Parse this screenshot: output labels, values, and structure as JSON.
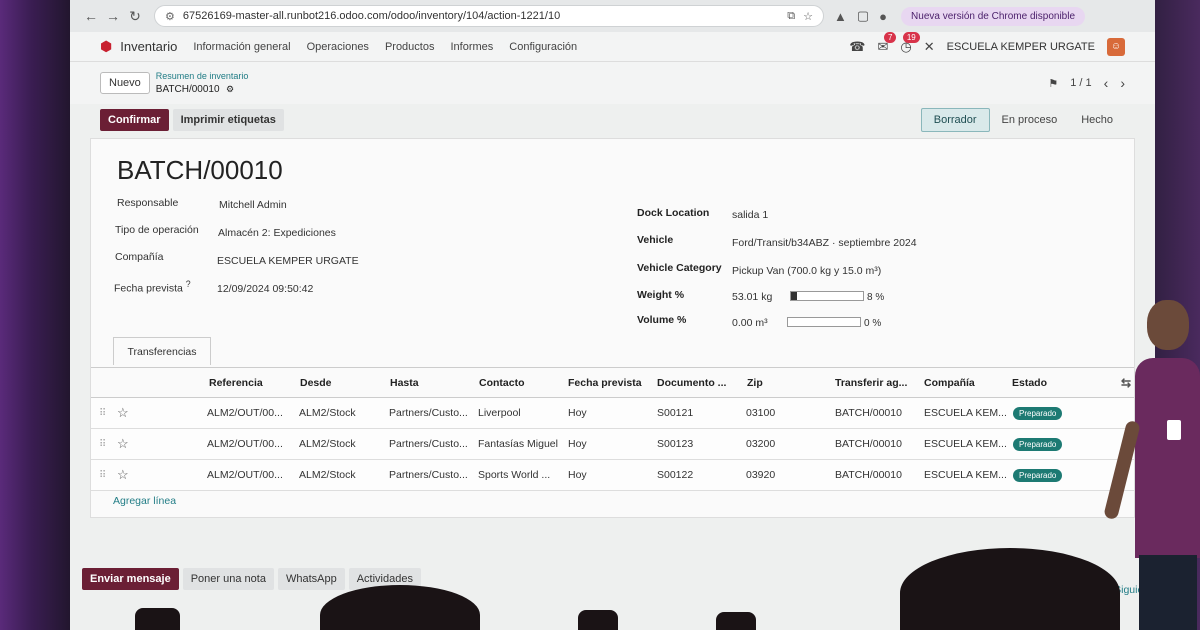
{
  "browser": {
    "url": "67526169-master-all.runbot216.odoo.com/odoo/inventory/104/action-1221/10",
    "chrome_update": "Nueva versión de Chrome disponible"
  },
  "nav": {
    "app_name": "Inventario",
    "menu": [
      "Información general",
      "Operaciones",
      "Productos",
      "Informes",
      "Configuración"
    ],
    "badges": {
      "messages": "7",
      "activities": "19"
    },
    "company": "ESCUELA KEMPER URGATE"
  },
  "control": {
    "new_label": "Nuevo",
    "breadcrumb_parent": "Resumen de inventario",
    "breadcrumb_current": "BATCH/00010",
    "pager": "1 / 1"
  },
  "actions": {
    "confirm": "Confirmar",
    "print_labels": "Imprimir etiquetas"
  },
  "statusbar": {
    "steps": [
      "Borrador",
      "En proceso",
      "Hecho"
    ],
    "active": "Borrador"
  },
  "form": {
    "title": "BATCH/00010",
    "left": {
      "responsable_label": "Responsable",
      "responsable": "Mitchell Admin",
      "tipo_label": "Tipo de operación",
      "tipo": "Almacén 2: Expediciones",
      "compania_label": "Compañía",
      "compania": "ESCUELA KEMPER URGATE",
      "fecha_label": "Fecha prevista",
      "fecha_help": "?",
      "fecha": "12/09/2024 09:50:42"
    },
    "right": {
      "dock_label": "Dock Location",
      "dock": "salida 1",
      "vehicle_label": "Vehicle",
      "vehicle": "Ford/Transit/b34ABZ · septiembre 2024",
      "vehicle_cat_label": "Vehicle Category",
      "vehicle_cat": "Pickup Van (700.0 kg y 15.0 m³)",
      "weight_label": "Weight %",
      "weight": "53.01 kg",
      "weight_pct_text": "8 %",
      "weight_fraction": 0.08,
      "volume_label": "Volume %",
      "volume": "0.00 m³",
      "volume_pct_text": "0 %",
      "volume_fraction": 0.0
    },
    "tab": "Transferencias"
  },
  "table": {
    "headers": [
      "Referencia",
      "Desde",
      "Hasta",
      "Contacto",
      "Fecha prevista",
      "Documento ...",
      "Zip",
      "Transferir ag...",
      "Compañía",
      "Estado"
    ],
    "rows": [
      [
        "ALM2/OUT/00...",
        "ALM2/Stock",
        "Partners/Custo...",
        "Liverpool",
        "Hoy",
        "S00121",
        "03100",
        "BATCH/00010",
        "ESCUELA KEM...",
        "Preparado"
      ],
      [
        "ALM2/OUT/00...",
        "ALM2/Stock",
        "Partners/Custo...",
        "Fantasías Miguel",
        "Hoy",
        "S00123",
        "03200",
        "BATCH/00010",
        "ESCUELA KEM...",
        "Preparado"
      ],
      [
        "ALM2/OUT/00...",
        "ALM2/Stock",
        "Partners/Custo...",
        "Sports World ...",
        "Hoy",
        "S00122",
        "03920",
        "BATCH/00010",
        "ESCUELA KEM...",
        "Preparado"
      ]
    ],
    "add_line": "Agregar línea"
  },
  "chatter": {
    "send_message": "Enviar mensaje",
    "log_note": "Poner una nota",
    "whatsapp": "WhatsApp",
    "activities": "Actividades",
    "next": "Siguiend"
  },
  "colors": {
    "primary": "#6b1f35",
    "accent_link": "#227d86",
    "status_ready": "#1d7a73"
  }
}
